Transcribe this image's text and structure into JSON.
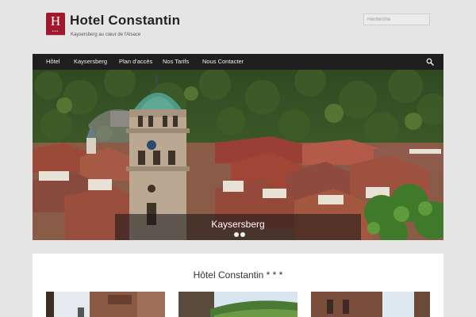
{
  "site": {
    "logo_letter": "H",
    "logo_dots": "•••",
    "title": "Hotel Constantin",
    "tagline": "Kaysersberg au cœur de l'Alsace"
  },
  "search": {
    "placeholder": "Recherche"
  },
  "nav": {
    "items": [
      {
        "label": "Hôtel"
      },
      {
        "label": "Kaysersberg"
      },
      {
        "label": "Plan d'accès"
      },
      {
        "label": "Nos Tarifs"
      },
      {
        "label": "Nous Contacter"
      }
    ],
    "search_icon": "search-icon"
  },
  "slider": {
    "caption": "Kaysersberg",
    "slide_count": 2,
    "active_slide": 1
  },
  "main": {
    "title": "Hôtel Constantin * * *",
    "thumbnails": [
      "street-photo",
      "vineyard-photo",
      "church-photo"
    ]
  },
  "colors": {
    "brand": "#a0182e",
    "nav_bg": "#1e1e1e",
    "page_bg": "#e6e6e6"
  }
}
